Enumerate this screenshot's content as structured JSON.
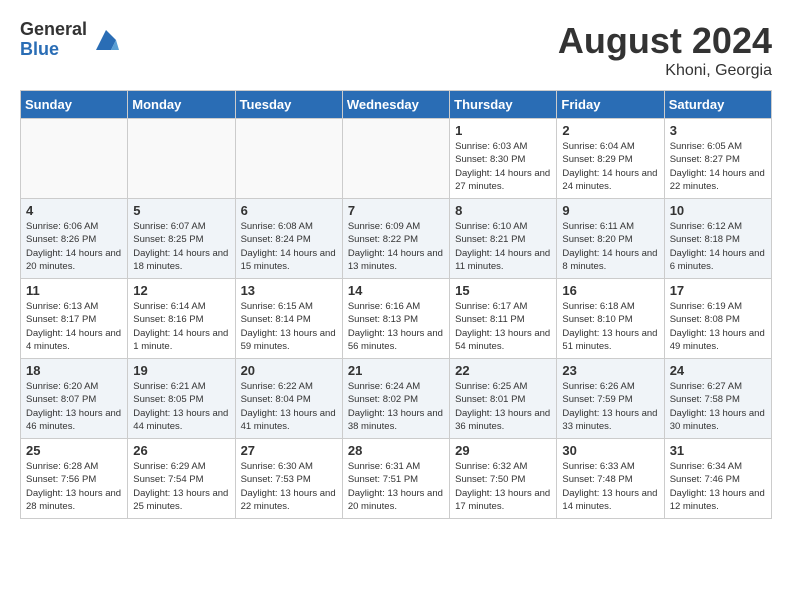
{
  "header": {
    "logo_general": "General",
    "logo_blue": "Blue",
    "month_year": "August 2024",
    "location": "Khoni, Georgia"
  },
  "weekdays": [
    "Sunday",
    "Monday",
    "Tuesday",
    "Wednesday",
    "Thursday",
    "Friday",
    "Saturday"
  ],
  "weeks": [
    [
      {
        "day": "",
        "info": ""
      },
      {
        "day": "",
        "info": ""
      },
      {
        "day": "",
        "info": ""
      },
      {
        "day": "",
        "info": ""
      },
      {
        "day": "1",
        "info": "Sunrise: 6:03 AM\nSunset: 8:30 PM\nDaylight: 14 hours and 27 minutes."
      },
      {
        "day": "2",
        "info": "Sunrise: 6:04 AM\nSunset: 8:29 PM\nDaylight: 14 hours and 24 minutes."
      },
      {
        "day": "3",
        "info": "Sunrise: 6:05 AM\nSunset: 8:27 PM\nDaylight: 14 hours and 22 minutes."
      }
    ],
    [
      {
        "day": "4",
        "info": "Sunrise: 6:06 AM\nSunset: 8:26 PM\nDaylight: 14 hours and 20 minutes."
      },
      {
        "day": "5",
        "info": "Sunrise: 6:07 AM\nSunset: 8:25 PM\nDaylight: 14 hours and 18 minutes."
      },
      {
        "day": "6",
        "info": "Sunrise: 6:08 AM\nSunset: 8:24 PM\nDaylight: 14 hours and 15 minutes."
      },
      {
        "day": "7",
        "info": "Sunrise: 6:09 AM\nSunset: 8:22 PM\nDaylight: 14 hours and 13 minutes."
      },
      {
        "day": "8",
        "info": "Sunrise: 6:10 AM\nSunset: 8:21 PM\nDaylight: 14 hours and 11 minutes."
      },
      {
        "day": "9",
        "info": "Sunrise: 6:11 AM\nSunset: 8:20 PM\nDaylight: 14 hours and 8 minutes."
      },
      {
        "day": "10",
        "info": "Sunrise: 6:12 AM\nSunset: 8:18 PM\nDaylight: 14 hours and 6 minutes."
      }
    ],
    [
      {
        "day": "11",
        "info": "Sunrise: 6:13 AM\nSunset: 8:17 PM\nDaylight: 14 hours and 4 minutes."
      },
      {
        "day": "12",
        "info": "Sunrise: 6:14 AM\nSunset: 8:16 PM\nDaylight: 14 hours and 1 minute."
      },
      {
        "day": "13",
        "info": "Sunrise: 6:15 AM\nSunset: 8:14 PM\nDaylight: 13 hours and 59 minutes."
      },
      {
        "day": "14",
        "info": "Sunrise: 6:16 AM\nSunset: 8:13 PM\nDaylight: 13 hours and 56 minutes."
      },
      {
        "day": "15",
        "info": "Sunrise: 6:17 AM\nSunset: 8:11 PM\nDaylight: 13 hours and 54 minutes."
      },
      {
        "day": "16",
        "info": "Sunrise: 6:18 AM\nSunset: 8:10 PM\nDaylight: 13 hours and 51 minutes."
      },
      {
        "day": "17",
        "info": "Sunrise: 6:19 AM\nSunset: 8:08 PM\nDaylight: 13 hours and 49 minutes."
      }
    ],
    [
      {
        "day": "18",
        "info": "Sunrise: 6:20 AM\nSunset: 8:07 PM\nDaylight: 13 hours and 46 minutes."
      },
      {
        "day": "19",
        "info": "Sunrise: 6:21 AM\nSunset: 8:05 PM\nDaylight: 13 hours and 44 minutes."
      },
      {
        "day": "20",
        "info": "Sunrise: 6:22 AM\nSunset: 8:04 PM\nDaylight: 13 hours and 41 minutes."
      },
      {
        "day": "21",
        "info": "Sunrise: 6:24 AM\nSunset: 8:02 PM\nDaylight: 13 hours and 38 minutes."
      },
      {
        "day": "22",
        "info": "Sunrise: 6:25 AM\nSunset: 8:01 PM\nDaylight: 13 hours and 36 minutes."
      },
      {
        "day": "23",
        "info": "Sunrise: 6:26 AM\nSunset: 7:59 PM\nDaylight: 13 hours and 33 minutes."
      },
      {
        "day": "24",
        "info": "Sunrise: 6:27 AM\nSunset: 7:58 PM\nDaylight: 13 hours and 30 minutes."
      }
    ],
    [
      {
        "day": "25",
        "info": "Sunrise: 6:28 AM\nSunset: 7:56 PM\nDaylight: 13 hours and 28 minutes."
      },
      {
        "day": "26",
        "info": "Sunrise: 6:29 AM\nSunset: 7:54 PM\nDaylight: 13 hours and 25 minutes."
      },
      {
        "day": "27",
        "info": "Sunrise: 6:30 AM\nSunset: 7:53 PM\nDaylight: 13 hours and 22 minutes."
      },
      {
        "day": "28",
        "info": "Sunrise: 6:31 AM\nSunset: 7:51 PM\nDaylight: 13 hours and 20 minutes."
      },
      {
        "day": "29",
        "info": "Sunrise: 6:32 AM\nSunset: 7:50 PM\nDaylight: 13 hours and 17 minutes."
      },
      {
        "day": "30",
        "info": "Sunrise: 6:33 AM\nSunset: 7:48 PM\nDaylight: 13 hours and 14 minutes."
      },
      {
        "day": "31",
        "info": "Sunrise: 6:34 AM\nSunset: 7:46 PM\nDaylight: 13 hours and 12 minutes."
      }
    ]
  ]
}
